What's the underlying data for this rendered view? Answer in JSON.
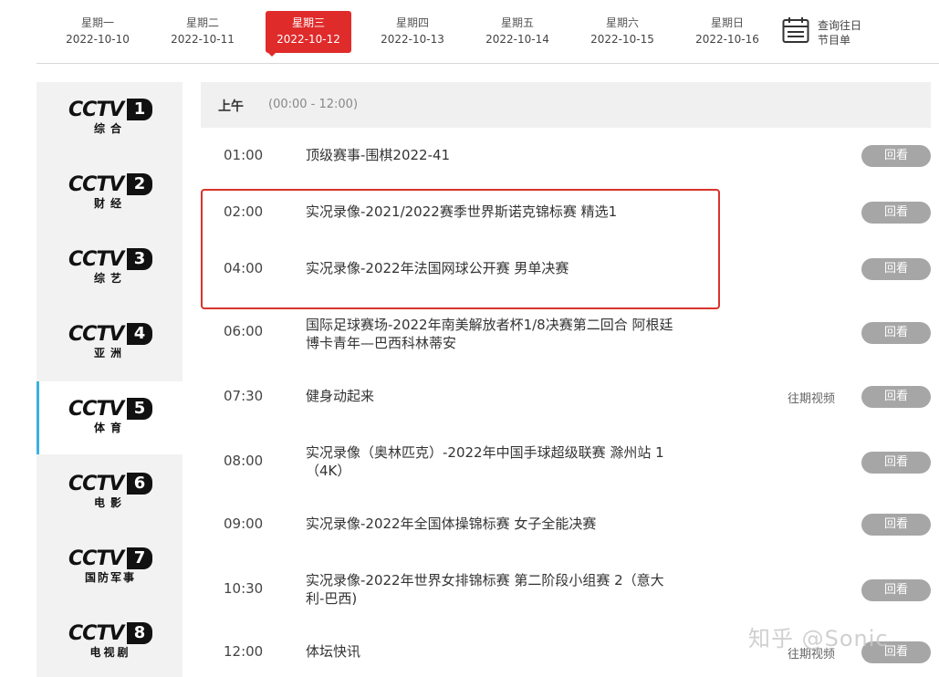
{
  "dates": [
    {
      "weekday": "星期一",
      "date": "2022-10-10",
      "active": false
    },
    {
      "weekday": "星期二",
      "date": "2022-10-11",
      "active": false
    },
    {
      "weekday": "星期三",
      "date": "2022-10-12",
      "active": true
    },
    {
      "weekday": "星期四",
      "date": "2022-10-13",
      "active": false
    },
    {
      "weekday": "星期五",
      "date": "2022-10-14",
      "active": false
    },
    {
      "weekday": "星期六",
      "date": "2022-10-15",
      "active": false
    },
    {
      "weekday": "星期日",
      "date": "2022-10-16",
      "active": false
    }
  ],
  "history": {
    "line1": "查询往日",
    "line2": "节目单",
    "icon": "calendar-icon"
  },
  "channels": [
    {
      "logo": "CCTV",
      "num": "1",
      "sub": "综合",
      "active": false
    },
    {
      "logo": "CCTV",
      "num": "2",
      "sub": "财经",
      "active": false
    },
    {
      "logo": "CCTV",
      "num": "3",
      "sub": "综艺",
      "active": false
    },
    {
      "logo": "CCTV",
      "num": "4",
      "sub": "亚洲",
      "active": false
    },
    {
      "logo": "CCTV",
      "num": "5",
      "sub": "体育",
      "active": true
    },
    {
      "logo": "CCTV",
      "num": "6",
      "sub": "电影",
      "active": false
    },
    {
      "logo": "CCTV",
      "num": "7",
      "sub": "国防军事",
      "active": false
    },
    {
      "logo": "CCTV",
      "num": "8",
      "sub": "电视剧",
      "active": false
    }
  ],
  "period": {
    "label": "上午",
    "range": "(00:00 - 12:00)"
  },
  "programs": [
    {
      "time": "01:00",
      "title": "顶级赛事-围棋2022-41",
      "past_label": "",
      "replay": "回看"
    },
    {
      "time": "02:00",
      "title": "实况录像-2021/2022赛季世界斯诺克锦标赛 精选1",
      "past_label": "",
      "replay": "回看"
    },
    {
      "time": "04:00",
      "title": "实况录像-2022年法国网球公开赛 男单决赛",
      "past_label": "",
      "replay": "回看"
    },
    {
      "time": "06:00",
      "title": "国际足球赛场-2022年南美解放者杯1/8决赛第二回合 阿根廷博卡青年—巴西科林蒂安",
      "past_label": "",
      "replay": "回看"
    },
    {
      "time": "07:30",
      "title": "健身动起来",
      "past_label": "往期视频",
      "replay": "回看"
    },
    {
      "time": "08:00",
      "title": "实况录像（奥林匹克）-2022年中国手球超级联赛 滁州站 1（4K）",
      "past_label": "",
      "replay": "回看"
    },
    {
      "time": "09:00",
      "title": "实况录像-2022年全国体操锦标赛 女子全能决赛",
      "past_label": "",
      "replay": "回看"
    },
    {
      "time": "10:30",
      "title": "实况录像-2022年世界女排锦标赛 第二阶段小组赛 2（意大利-巴西)",
      "past_label": "",
      "replay": "回看"
    },
    {
      "time": "12:00",
      "title": "体坛快讯",
      "past_label": "往期视频",
      "replay": "回看"
    }
  ],
  "watermark": "知乎 @Sonic",
  "colors": {
    "active_date": "#e02b2b",
    "replay_button": "#a6a6a6",
    "highlight_box": "#d9342b",
    "active_channel_border": "#3ab0e2"
  }
}
